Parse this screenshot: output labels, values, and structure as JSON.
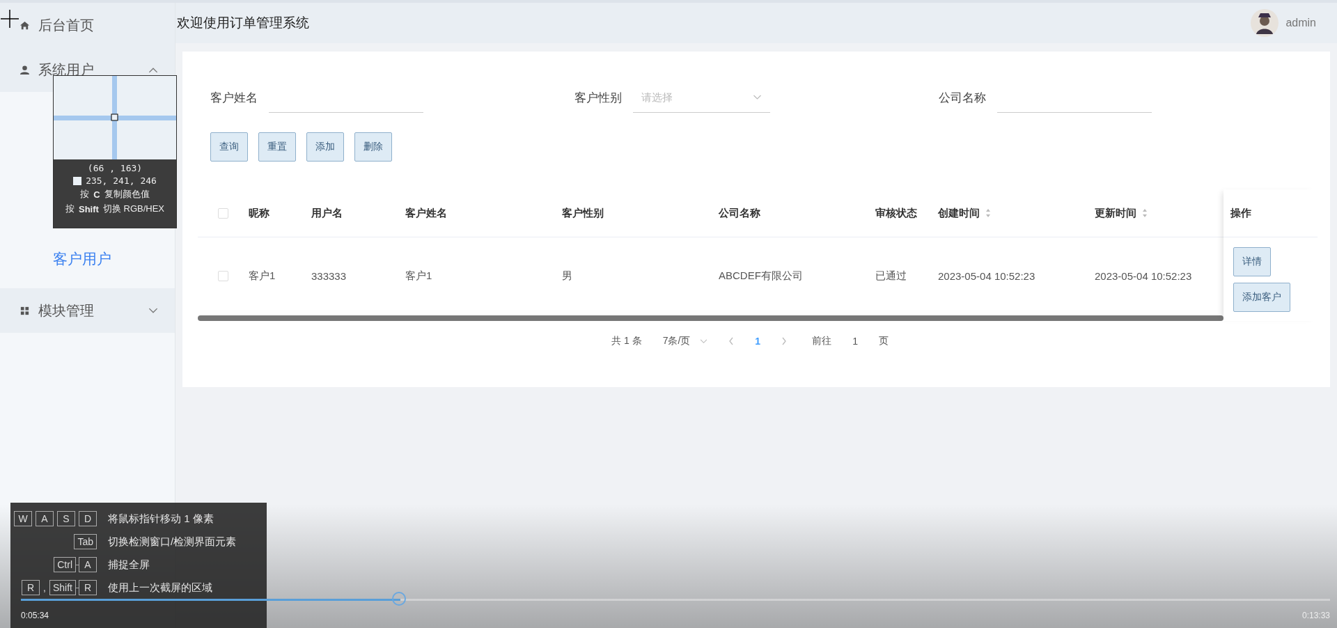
{
  "sidebar": {
    "items": [
      {
        "kind": "link",
        "label": "后台首页"
      },
      {
        "kind": "group",
        "label": "系统用户",
        "expanded": true,
        "children": [
          {
            "label": "客户用户",
            "selected": true
          }
        ]
      },
      {
        "kind": "group",
        "label": "模块管理",
        "expanded": false
      }
    ]
  },
  "header": {
    "title": "欢迎使用订单管理系统",
    "user": "admin"
  },
  "filters": [
    {
      "kind": "text",
      "label": "客户姓名"
    },
    {
      "kind": "select",
      "label": "客户性别",
      "placeholder": "请选择"
    },
    {
      "kind": "text",
      "label": "公司名称"
    }
  ],
  "buttons": [
    "查询",
    "重置",
    "添加",
    "删除"
  ],
  "table": {
    "select_all_checked": false,
    "columns": [
      {
        "label": "昵称",
        "sortable": false
      },
      {
        "label": "用户名",
        "sortable": false
      },
      {
        "label": "客户姓名",
        "sortable": false
      },
      {
        "label": "客户性别",
        "sortable": false
      },
      {
        "label": "公司名称",
        "sortable": false
      },
      {
        "label": "审核状态",
        "sortable": false
      },
      {
        "label": "创建时间",
        "sortable": true
      },
      {
        "label": "更新时间",
        "sortable": true
      }
    ],
    "action_column": "操作",
    "rows": [
      {
        "checked": false,
        "cells": [
          "客户1",
          "333333",
          "客户1",
          "男",
          "ABCDEF有限公司",
          "已通过",
          "2023-05-04 10:52:23",
          "2023-05-04 10:52:23"
        ],
        "actions": [
          "详情",
          "添加客户"
        ]
      }
    ]
  },
  "pagination": {
    "total": "共 1 条",
    "page_size": "7条/页",
    "pages": [
      {
        "label": "1",
        "selected": true
      }
    ],
    "goto_label": "前往",
    "goto_value": "1",
    "goto_suffix": "页"
  },
  "magnifier": {
    "coords": "(66 , 163)",
    "color_value": "235, 241, 246",
    "hints": [
      "按 **C** 复制颜色值",
      "按 **Shift** 切换 RGB/HEX"
    ]
  },
  "shortcuts": [
    {
      "keys": [
        {
          "kind": "key",
          "label": "W"
        },
        {
          "kind": "key",
          "label": "A"
        },
        {
          "kind": "key",
          "label": "S"
        },
        {
          "kind": "key",
          "label": "D"
        }
      ],
      "text": "将鼠标指针移动 1 像素"
    },
    {
      "keys": [
        {
          "kind": "key",
          "label": "Tab"
        }
      ],
      "text": "切换检测窗口/检测界面元素"
    },
    {
      "keys": [
        {
          "kind": "key",
          "label": "Ctrl"
        },
        {
          "kind": "combo",
          "label": "A"
        }
      ],
      "text": "捕捉全屏"
    },
    {
      "keys": [
        {
          "kind": "key",
          "label": "R"
        },
        {
          "kind": "sep",
          "label": ","
        },
        {
          "kind": "key",
          "label": "Shift"
        },
        {
          "kind": "combo",
          "label": "R"
        }
      ],
      "text": "使用上一次截屏的区域"
    }
  ],
  "player": {
    "level": 0.29,
    "elapsed": "0:05:34",
    "duration": "0:13:33"
  }
}
